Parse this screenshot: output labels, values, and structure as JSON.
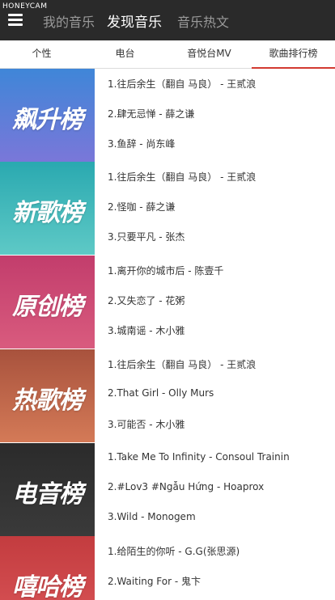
{
  "watermark": "HONEYCAM",
  "top_tabs": [
    "我的音乐",
    "发现音乐",
    "音乐热文"
  ],
  "sub_tabs": [
    "个性",
    "电台",
    "音悦台MV",
    "歌曲排行榜"
  ],
  "rankings": [
    {
      "title": "飙升榜",
      "color_top": "#3f86d8",
      "color_bottom": "#7a77d9",
      "songs": [
        "1.往后余生（翻自 马良） - 王贰浪",
        "2.肆无忌惮 - 薛之谦",
        "3.鱼辞 - 尚东峰"
      ]
    },
    {
      "title": "新歌榜",
      "color_top": "#2aa9b0",
      "color_bottom": "#5ec9c6",
      "songs": [
        "1.往后余生（翻自 马良） - 王贰浪",
        "2.怪咖 - 薛之谦",
        "3.只要平凡 - 张杰"
      ]
    },
    {
      "title": "原创榜",
      "color_top": "#c23d6c",
      "color_bottom": "#d95b7e",
      "songs": [
        "1.离开你的城市后 - 陈壹千",
        "2.又失恋了 - 花粥",
        "3.城南谣 - 木小雅"
      ]
    },
    {
      "title": "热歌榜",
      "color_top": "#a8523d",
      "color_bottom": "#d47a57",
      "songs": [
        "1.往后余生（翻自 马良） - 王贰浪",
        "2.That Girl - Olly Murs",
        "3.可能否 - 木小雅"
      ]
    },
    {
      "title": "电音榜",
      "color_top": "#2b2b2b",
      "color_bottom": "#3a3a3a",
      "songs": [
        "1.Take Me To Infinity - Consoul Trainin",
        "2.#Lov3 #Ngẫu Hứng - Hoaprox",
        "3.Wild - Monogem"
      ]
    },
    {
      "title": "嘻哈榜",
      "color_top": "#c33c3f",
      "color_bottom": "#d95457",
      "songs": [
        "1.给陌生的你听 - G.G(张思源)",
        "2.Waiting For - 鬼卞",
        ""
      ]
    }
  ]
}
